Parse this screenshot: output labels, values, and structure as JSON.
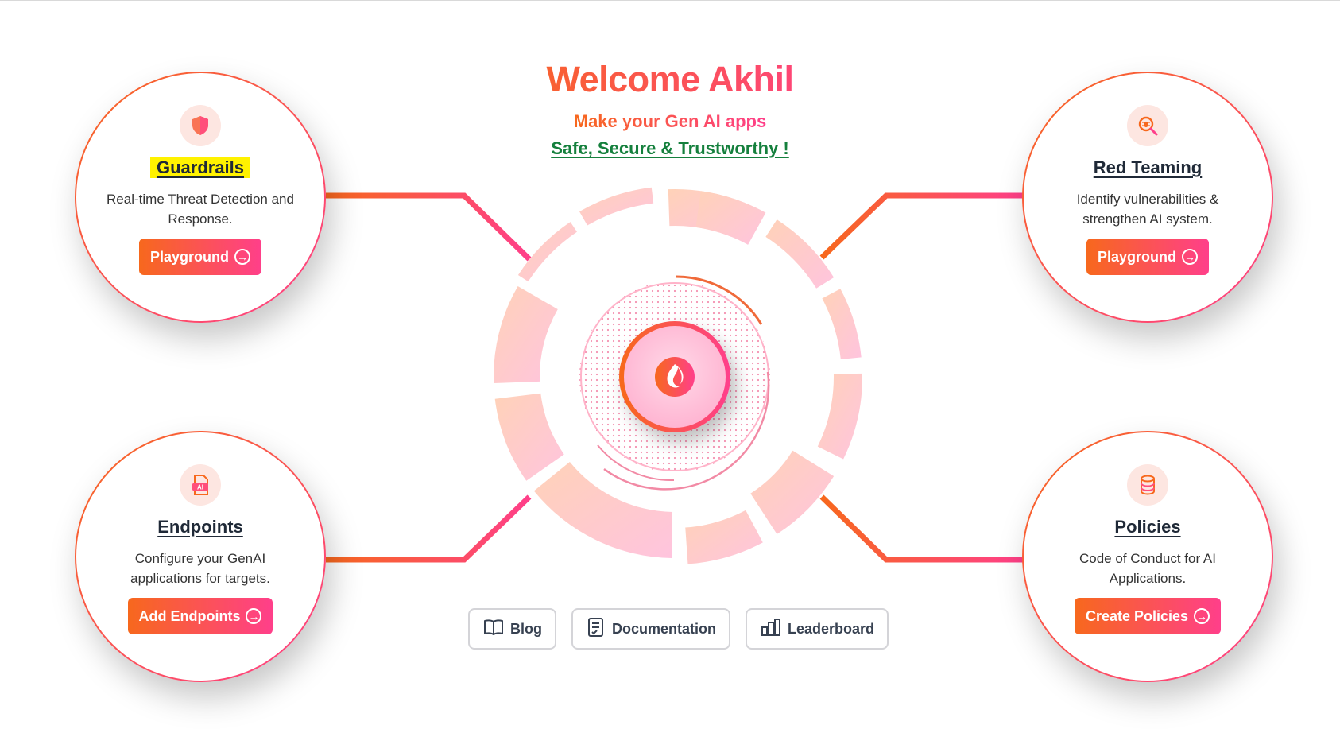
{
  "header": {
    "title": "Welcome Akhil",
    "subtitle": "Make your Gen AI apps",
    "tagline": "Safe, Secure & Trustworthy !"
  },
  "cards": [
    {
      "title": "Guardrails",
      "description": "Real-time Threat Detection and Response.",
      "button": "Playground",
      "icon": "shield-icon"
    },
    {
      "title": "Red Teaming",
      "description": "Identify vulnerabilities & strengthen AI system.",
      "button": "Playground",
      "icon": "bug-search-icon"
    },
    {
      "title": "Endpoints",
      "description": "Configure your GenAI applications for targets.",
      "button": "Add Endpoints",
      "icon": "ai-file-icon"
    },
    {
      "title": "Policies",
      "description": "Code of Conduct for AI Applications.",
      "button": "Create Policies",
      "icon": "database-icon"
    }
  ],
  "links": [
    {
      "label": "Blog",
      "icon": "book-icon"
    },
    {
      "label": "Documentation",
      "icon": "document-icon"
    },
    {
      "label": "Leaderboard",
      "icon": "bar-chart-icon"
    }
  ],
  "colors": {
    "accent_orange": "#f7681d",
    "accent_pink": "#ff3f8a",
    "tagline_green": "#15803d",
    "highlight_yellow": "#fff200"
  }
}
